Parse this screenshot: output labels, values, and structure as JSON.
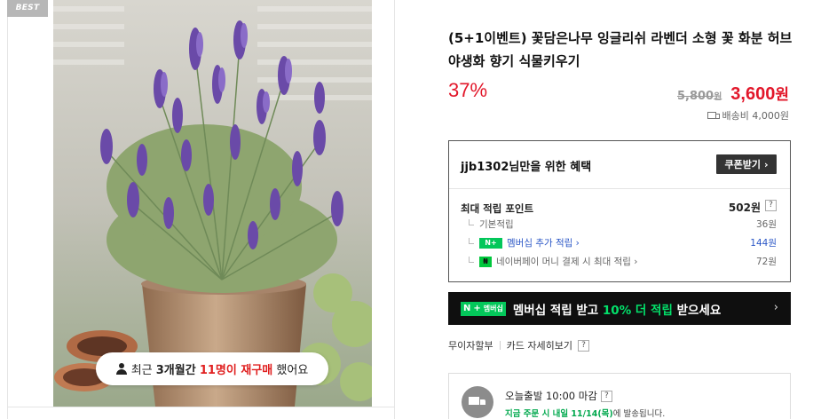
{
  "badge": "BEST",
  "repurchase": {
    "prefix": "최근",
    "period": "3개월간",
    "count": "11명이 재구매",
    "suffix": "했어요"
  },
  "product": {
    "title": "(5+1이벤트) 꽃담은나무 잉글리쉬 라벤더 소형 꽃 화분 허브 야생화 향기 식물키우기",
    "discount": "37%",
    "original_price": "5,800",
    "sale_price": "3,600",
    "currency": "원",
    "shipping": "배송비 4,000원"
  },
  "benefit": {
    "title": "jjb1302님만을 위한 혜택",
    "coupon_button": "쿠폰받기",
    "max_point_label": "최대 적립 포인트",
    "max_point_value": "502원",
    "rows": [
      {
        "label": "기본적립",
        "value": "36원"
      },
      {
        "label": "멤버십 추가 적립",
        "value": "144원"
      },
      {
        "label": "네이버페이 머니 결제 시 최대 적립",
        "value": "72원"
      }
    ]
  },
  "membership_banner": {
    "badge_text": "멤버십",
    "text_before": "멤버십 적립 받고 ",
    "text_highlight": "10% 더 적립",
    "text_after": " 받으세요"
  },
  "installment": {
    "free": "무이자할부",
    "card_detail": "카드 자세히보기"
  },
  "delivery": {
    "title": "오늘출발 10:00 마감",
    "sub_highlight": "지금 주문 시 내일 11/14(목)",
    "sub_after": "에 발송됩니다."
  },
  "colors": {
    "accent_red": "#e2172a",
    "naver_green": "#03c75a",
    "link_blue": "#2a56c6"
  }
}
